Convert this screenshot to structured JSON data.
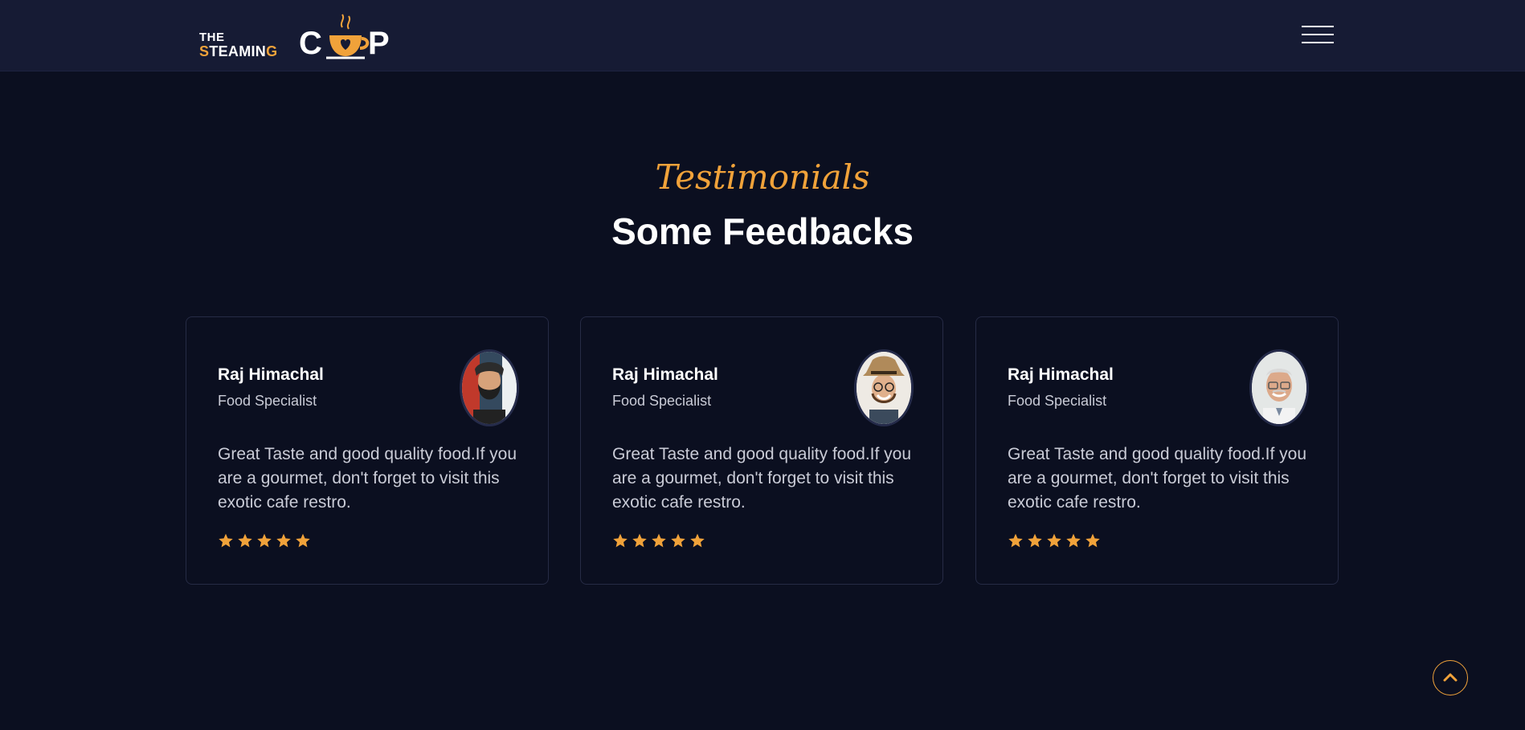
{
  "brand": {
    "the": "THE",
    "steaming_s": "S",
    "steaming_mid": "TEAMIN",
    "steaming_g": "G",
    "cup_c": "C",
    "cup_p": "P"
  },
  "colors": {
    "background": "#0b0f20",
    "navbar": "#161b34",
    "accent": "#f0a23a",
    "text": "#ffffff",
    "muted_text": "#c9cbd6"
  },
  "nav": {
    "menu_icon": "hamburger-menu-icon"
  },
  "section": {
    "subtitle": "Testimonials",
    "title": "Some Feedbacks"
  },
  "testimonials": [
    {
      "name": "Raj Himachal",
      "role": "Food Specialist",
      "quote": "Great Taste and good quality food.If you are a gourmet, don't forget to visit this exotic cafe restro.",
      "rating": 5,
      "avatar_icon": "bearded-man-avatar"
    },
    {
      "name": "Raj Himachal",
      "role": "Food Specialist",
      "quote": "Great Taste and good quality food.If you are a gourmet, don't forget to visit this exotic cafe restro.",
      "rating": 5,
      "avatar_icon": "man-with-hat-avatar"
    },
    {
      "name": "Raj Himachal",
      "role": "Food Specialist",
      "quote": "Great Taste and good quality food.If you are a gourmet, don't forget to visit this exotic cafe restro.",
      "rating": 5,
      "avatar_icon": "older-man-avatar"
    }
  ],
  "scroll_top_icon": "chevron-up-icon"
}
